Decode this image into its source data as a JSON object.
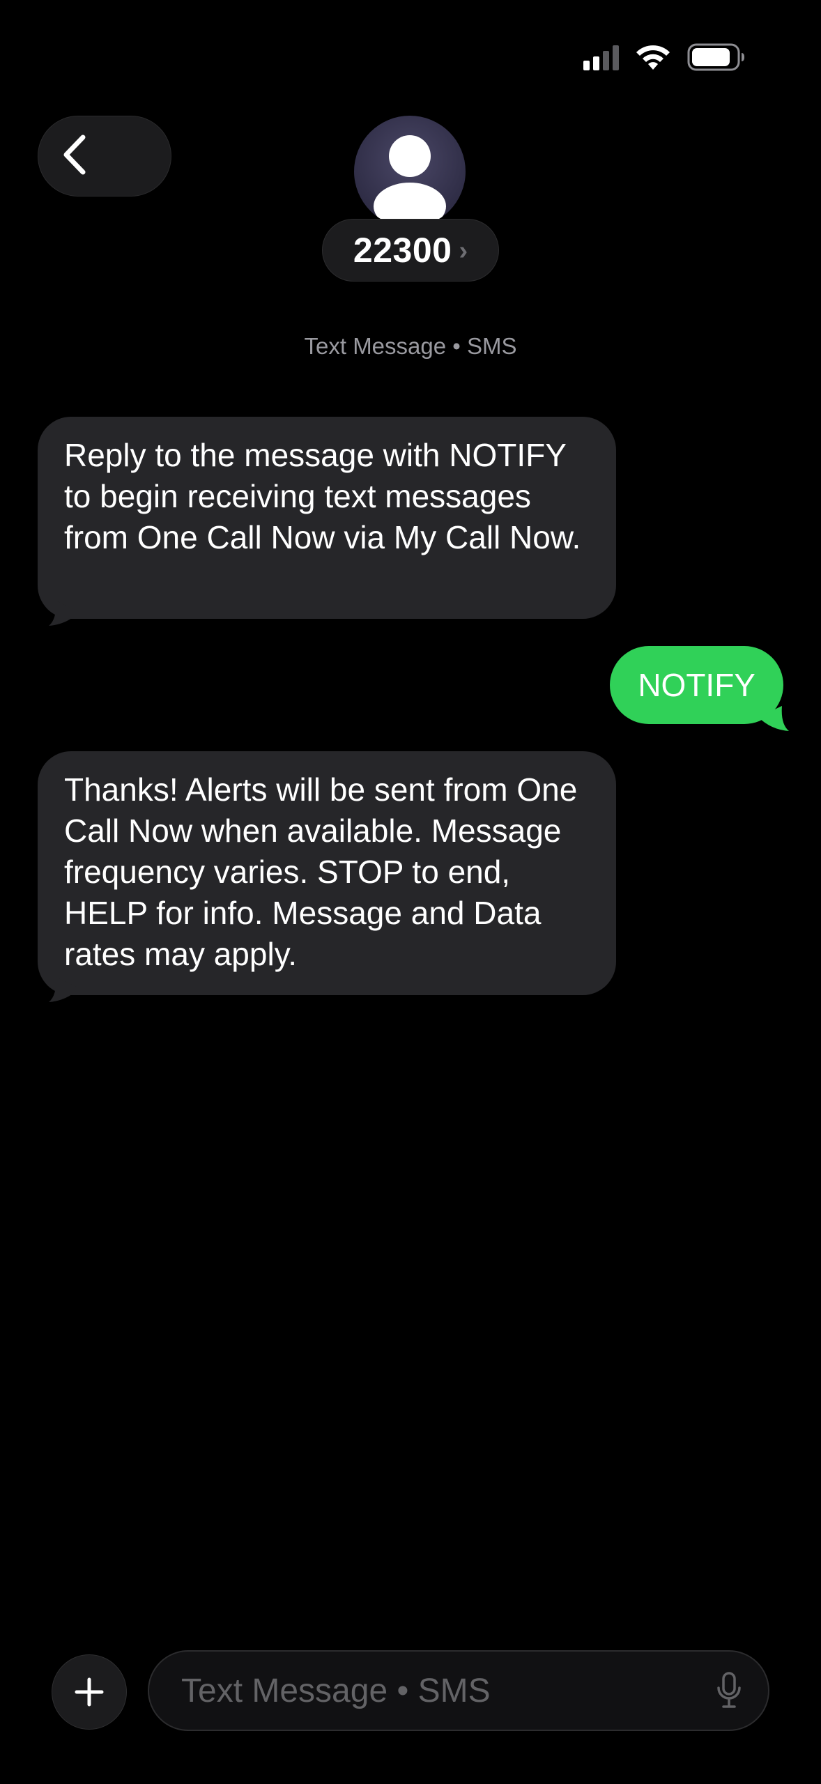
{
  "status_bar": {
    "signal_icon": "cellular-signal-icon",
    "wifi_icon": "wifi-icon",
    "battery_icon": "battery-icon",
    "battery_level": 0.85
  },
  "header": {
    "back_icon": "chevron-left-icon",
    "avatar_icon": "person-icon",
    "contact_name": "22300",
    "contact_chevron": "›"
  },
  "conversation": {
    "service_label": "Text Message • SMS",
    "messages": [
      {
        "direction": "incoming",
        "text": "Reply to the message with NOTIFY to begin receiving text messages from One Call Now via My Call Now."
      },
      {
        "direction": "outgoing",
        "text": "NOTIFY"
      },
      {
        "direction": "incoming",
        "text": "Thanks! Alerts will be sent from One Call Now when available. Message frequency varies. STOP to end, HELP for info. Message and Data rates may apply."
      }
    ]
  },
  "composer": {
    "plus_icon": "plus-icon",
    "placeholder": "Text Message • SMS",
    "value": "",
    "mic_icon": "microphone-icon"
  },
  "colors": {
    "background": "#000000",
    "incoming_bubble": "#262629",
    "outgoing_bubble": "#30d158",
    "secondary_text": "#9a9aa0"
  }
}
